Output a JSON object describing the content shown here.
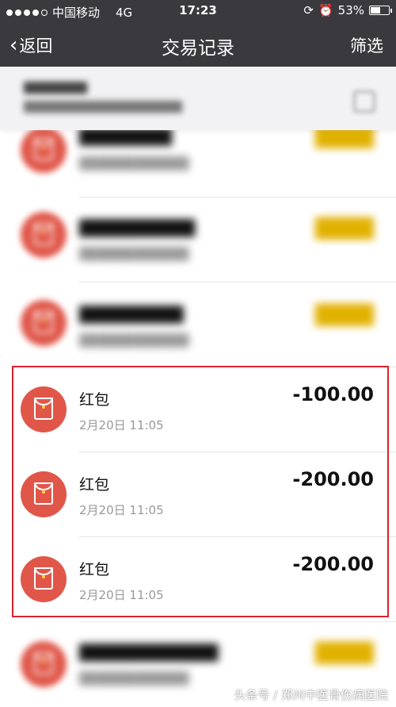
{
  "status": {
    "carrier": "中国移动",
    "network": "4G",
    "time": "17:23",
    "battery": "53%",
    "battery_level": 0.53
  },
  "nav": {
    "back_label": "返回",
    "title": "交易记录",
    "filter_label": "筛选"
  },
  "month_header": {
    "title": "",
    "subtitle": ""
  },
  "transactions": [
    {
      "name": "",
      "date": "",
      "amount": "",
      "blurred": true
    },
    {
      "name": "",
      "date": "",
      "amount": "",
      "blurred": true
    },
    {
      "name": "",
      "date": "",
      "amount": "",
      "blurred": true
    },
    {
      "name": "红包",
      "date": "2月20日 11:05",
      "amount": "-100.00",
      "blurred": false
    },
    {
      "name": "红包",
      "date": "2月20日 11:05",
      "amount": "-200.00",
      "blurred": false
    },
    {
      "name": "红包",
      "date": "2月20日 11:05",
      "amount": "-200.00",
      "blurred": false
    },
    {
      "name": "",
      "date": "",
      "amount": "",
      "blurred": true
    }
  ],
  "watermark": "头条号 / 郑州中医骨伤病医院",
  "colors": {
    "nav_bg": "#3a3a3e",
    "icon_red": "#e0574a",
    "highlight": "#d9232e",
    "income": "#e1b100"
  }
}
